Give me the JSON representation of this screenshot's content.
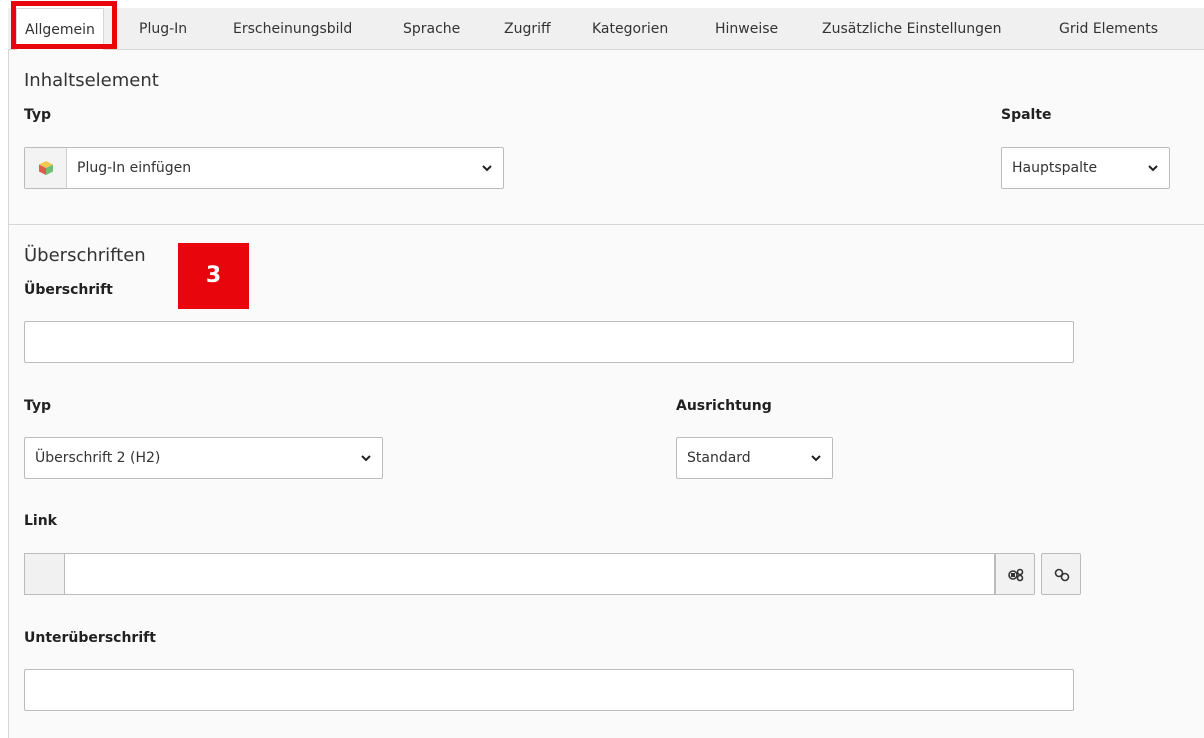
{
  "tabs": [
    {
      "label": "Allgemein",
      "active": true
    },
    {
      "label": "Plug-In"
    },
    {
      "label": "Erscheinungsbild"
    },
    {
      "label": "Sprache"
    },
    {
      "label": "Zugriff"
    },
    {
      "label": "Kategorien"
    },
    {
      "label": "Hinweise"
    },
    {
      "label": "Zusätzliche Einstellungen"
    },
    {
      "label": "Grid Elements"
    }
  ],
  "content_element": {
    "section_title": "Inhaltselement",
    "type_label": "Typ",
    "type_value": "Plug-In einfügen",
    "type_icon": "plugin-cube-icon",
    "column_label": "Spalte",
    "column_value": "Hauptspalte"
  },
  "headers": {
    "section_title": "Überschriften",
    "badge": "3",
    "header_label": "Überschrift",
    "header_value": "",
    "type_label": "Typ",
    "type_value": "Überschrift 2 (H2)",
    "align_label": "Ausrichtung",
    "align_value": "Standard",
    "link_label": "Link",
    "link_value": "",
    "subheader_label": "Unterüberschrift",
    "subheader_value": ""
  },
  "colors": {
    "highlight": "#e8060c",
    "panel_bg": "#fafafa",
    "tabbar_bg": "#f0f0f0"
  }
}
